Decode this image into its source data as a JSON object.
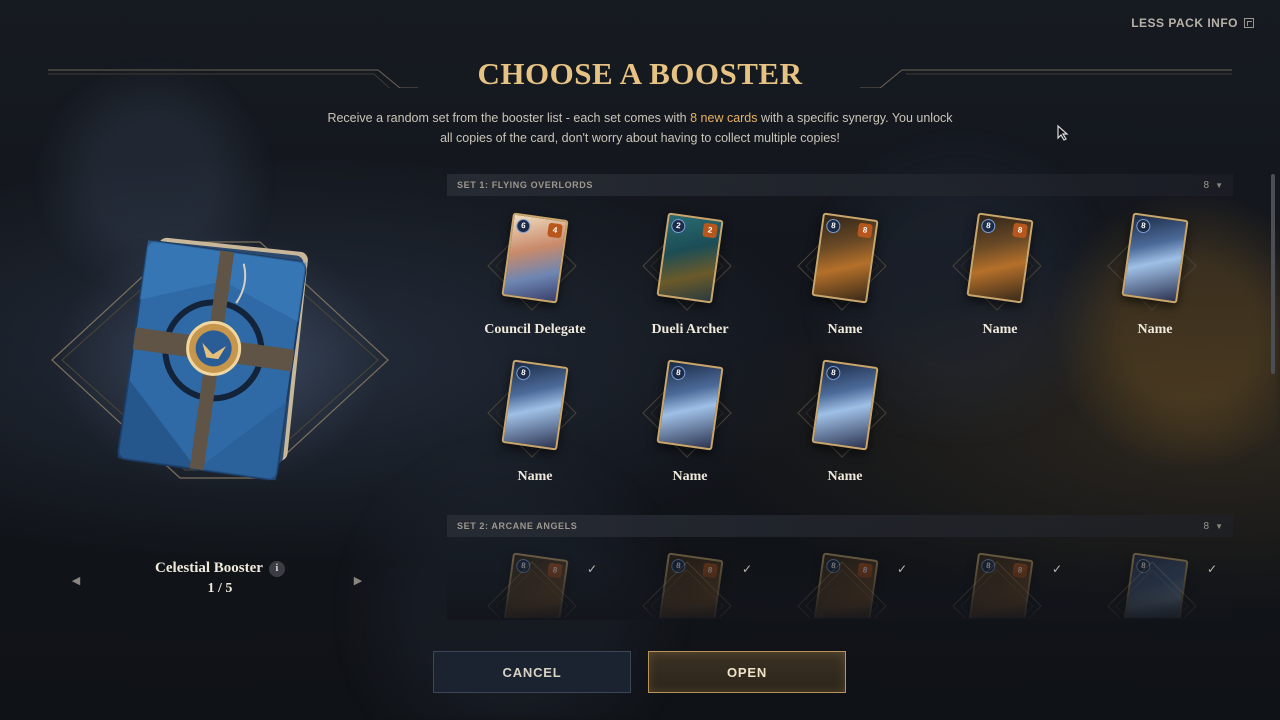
{
  "header": {
    "less_pack_info": "LESS PACK INFO",
    "title": "CHOOSE A BOOSTER",
    "subtitle_pre": "Receive a random set from the booster list - each set comes with ",
    "subtitle_highlight": "8 new cards",
    "subtitle_post": " with a specific synergy. You unlock all copies of the card, don't worry about having to collect multiple copies!"
  },
  "booster": {
    "name": "Celestial Booster",
    "info_icon_label": "i",
    "position": "1 / 5"
  },
  "sets": [
    {
      "title": "SET 1: FLYING OVERLORDS",
      "count": "8",
      "cards": [
        {
          "name": "Council Delegate",
          "mana": "6",
          "power": "4",
          "art": "delegate"
        },
        {
          "name": "Dueli Archer",
          "mana": "2",
          "power": "2",
          "art": "archer"
        },
        {
          "name": "Name",
          "mana": "8",
          "power": "8",
          "art": "warrior"
        },
        {
          "name": "Name",
          "mana": "8",
          "power": "8",
          "art": "warrior"
        },
        {
          "name": "Name",
          "mana": "8",
          "power": "",
          "art": "storm"
        },
        {
          "name": "Name",
          "mana": "8",
          "power": "",
          "art": "storm"
        },
        {
          "name": "Name",
          "mana": "8",
          "power": "",
          "art": "storm"
        },
        {
          "name": "Name",
          "mana": "8",
          "power": "",
          "art": "storm"
        }
      ]
    },
    {
      "title": "SET 2: ARCANE ANGELS",
      "count": "8",
      "cards": [
        {
          "mana": "8",
          "power": "8",
          "art": "warrior",
          "owned": true
        },
        {
          "mana": "8",
          "power": "8",
          "art": "warrior",
          "owned": true
        },
        {
          "mana": "8",
          "power": "8",
          "art": "warrior",
          "owned": true
        },
        {
          "mana": "8",
          "power": "8",
          "art": "warrior",
          "owned": true
        },
        {
          "mana": "8",
          "power": "",
          "art": "storm",
          "owned": true
        }
      ]
    }
  ],
  "buttons": {
    "cancel": "CANCEL",
    "open": "OPEN"
  },
  "colors": {
    "title_gold": "#e6c383",
    "highlight": "#e8b360",
    "card_border": "#c9a66b",
    "open_border": "#b8935a",
    "cancel_bg": "#1c2330"
  },
  "icons": {
    "collapse": "collapse-icon",
    "chevron": "chevron-down-icon",
    "check": "check-icon",
    "prev": "chevron-left-icon",
    "next": "chevron-right-icon",
    "info": "info-icon"
  }
}
